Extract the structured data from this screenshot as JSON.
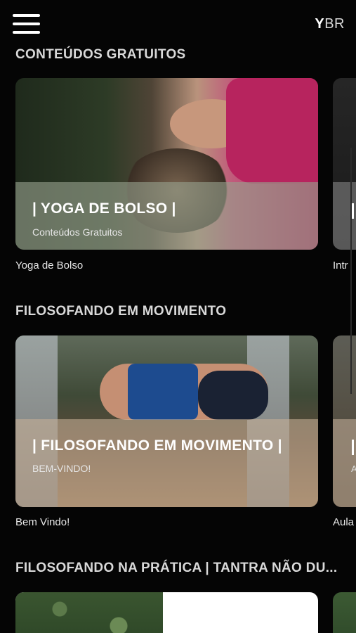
{
  "header": {
    "menu_icon": "hamburger-menu-icon",
    "brand_y": "Y",
    "brand_rest": "BR"
  },
  "sections": [
    {
      "title": "CONTEÚDOS GRATUITOS",
      "card": {
        "title": "| YOGA DE BOLSO |",
        "subtitle": "Conteúdos Gratuitos",
        "caption": "Yoga de Bolso"
      },
      "next_caption": "Intr"
    },
    {
      "title": "FILOSOFANDO EM MOVIMENTO",
      "card": {
        "title": "| FILOSOFANDO EM MOVIMENTO |",
        "subtitle": "BEM-VINDO!",
        "caption": "Bem Vindo!"
      },
      "next_caption": "Aula",
      "next_subtitle": "A"
    },
    {
      "title": "FILOSOFANDO NA PRÁTICA | TANTRA NÃO DU..."
    }
  ]
}
